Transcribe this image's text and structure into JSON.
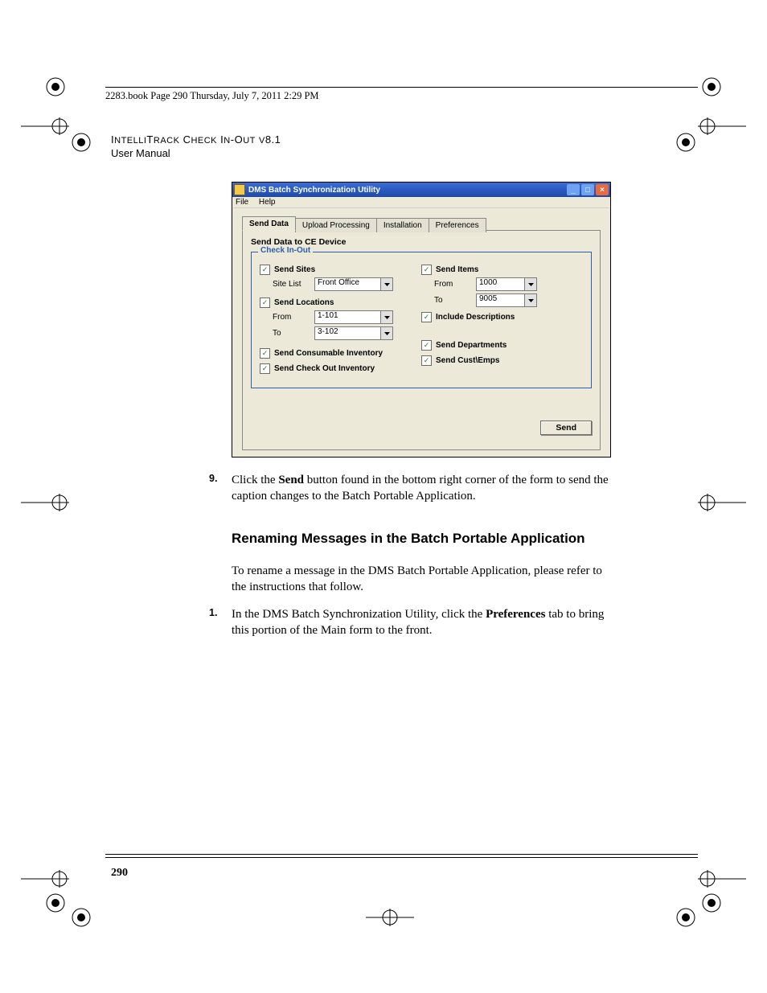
{
  "header": {
    "book_line": "2283.book  Page 290  Thursday, July 7, 2011  2:29 PM",
    "product": "IntelliTrack Check In-Out v8.1",
    "subtitle": "User Manual"
  },
  "screenshot": {
    "window_title": "DMS Batch Synchronization Utility",
    "menu": {
      "file": "File",
      "help": "Help"
    },
    "tabs": {
      "send_data": "Send Data",
      "upload_processing": "Upload Processing",
      "installation": "Installation",
      "preferences": "Preferences"
    },
    "section_title": "Send Data to CE Device",
    "group_legend": "Check In-Out",
    "left": {
      "send_sites": "Send Sites",
      "site_list_label": "Site List",
      "site_list_value": "Front Office",
      "send_locations": "Send Locations",
      "from_label": "From",
      "from_value": "1-101",
      "to_label": "To",
      "to_value": "3-102",
      "send_consumable": "Send Consumable Inventory",
      "send_checkout": "Send Check Out Inventory"
    },
    "right": {
      "send_items": "Send Items",
      "from_label": "From",
      "from_value": "1000",
      "to_label": "To",
      "to_value": "9005",
      "include_desc": "Include Descriptions",
      "send_departments": "Send Departments",
      "send_custemps": "Send Cust\\Emps"
    },
    "send_button": "Send"
  },
  "step9": {
    "num": "9.",
    "text_a": "Click the ",
    "bold": "Send",
    "text_b": " button found in the bottom right corner of the form to send the caption changes to the Batch Portable Application."
  },
  "heading2": "Renaming Messages in the Batch Portable Application",
  "para2": "To rename a message in the DMS Batch Portable Application, please refer to the instructions that follow.",
  "step1": {
    "num": "1.",
    "text_a": "In the DMS Batch Synchronization Utility, click the ",
    "bold": "Preferences",
    "text_b": " tab to bring this portion of the Main form to the front."
  },
  "page_number": "290"
}
